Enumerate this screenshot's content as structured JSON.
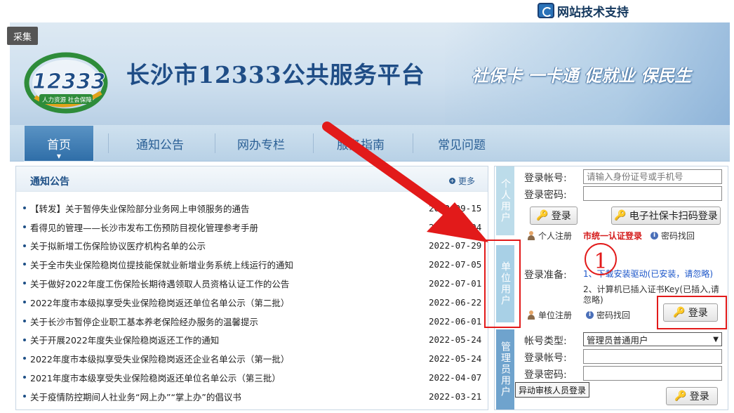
{
  "header": {
    "support_label": "网站技术支持",
    "caiji_label": "采集",
    "logo_number": "12333",
    "logo_sub": "人力资源 社会保障",
    "site_title": "长沙市12333公共服务平台",
    "slogan": "社保卡 一卡通 促就业 保民生"
  },
  "nav": {
    "items": [
      {
        "label": "首页"
      },
      {
        "label": "通知公告"
      },
      {
        "label": "网办专栏"
      },
      {
        "label": "服务指南"
      },
      {
        "label": "常见问题"
      }
    ]
  },
  "notice": {
    "title": "通知公告",
    "more_label": "更多",
    "items": [
      {
        "title": "【转发】关于暂停失业保险部分业务网上申领服务的通告",
        "date": "2022-09-15"
      },
      {
        "title": "看得见的管理——长沙市发布工伤预防目视化管理参考手册",
        "date": "2022-08-04"
      },
      {
        "title": "关于拟新增工伤保险协议医疗机构名单的公示",
        "date": "2022-07-29"
      },
      {
        "title": "关于全市失业保险稳岗位提技能保就业新增业务系统上线运行的通知",
        "date": "2022-07-05"
      },
      {
        "title": "关于做好2022年度工伤保险长期待遇领取人员资格认证工作的公告",
        "date": "2022-07-01"
      },
      {
        "title": "2022年度市本级拟享受失业保险稳岗返还单位名单公示（第二批）",
        "date": "2022-06-22"
      },
      {
        "title": "关于长沙市暂停企业职工基本养老保险经办服务的温馨提示",
        "date": "2022-06-01"
      },
      {
        "title": "关于开展2022年度失业保险稳岗返还工作的通知",
        "date": "2022-05-24"
      },
      {
        "title": "2022年度市本级拟享受失业保险稳岗返还企业名单公示（第一批）",
        "date": "2022-05-24"
      },
      {
        "title": "2021年度市本级享受失业保险稳岗返还单位名单公示（第三批）",
        "date": "2022-04-07"
      },
      {
        "title": "关于疫情防控期间人社业务“网上办”“掌上办”的倡议书",
        "date": "2022-03-21"
      }
    ]
  },
  "login": {
    "personal": {
      "tab_label": "个人用户",
      "account_label": "登录帐号:",
      "account_placeholder": "请输入身份证号或手机号",
      "password_label": "登录密码:",
      "login_button": "登录",
      "scan_button": "电子社保卡扫码登录",
      "register_label": "个人注册",
      "unified_label": "市统一认证登录",
      "forgot_label": "密码找回"
    },
    "unit": {
      "tab_label": "单位用户",
      "prepare_label": "登录准备:",
      "step1": "1、下载安装驱动(已安装，请忽略)",
      "step2": "2、计算机已插入证书Key(已插入,请忽略)",
      "register_label": "单位注册",
      "forgot_label": "密码找回",
      "login_button": "登录"
    },
    "admin": {
      "tab_label": "管理员用户",
      "type_label": "帐号类型:",
      "type_value": "管理员普通用户",
      "account_label": "登录帐号:",
      "password_label": "登录密码:",
      "login_button": "登录",
      "tooltip": "异动审核人员登录"
    }
  },
  "annotation": {
    "step_number": "1",
    "color": "#e21a1a"
  }
}
